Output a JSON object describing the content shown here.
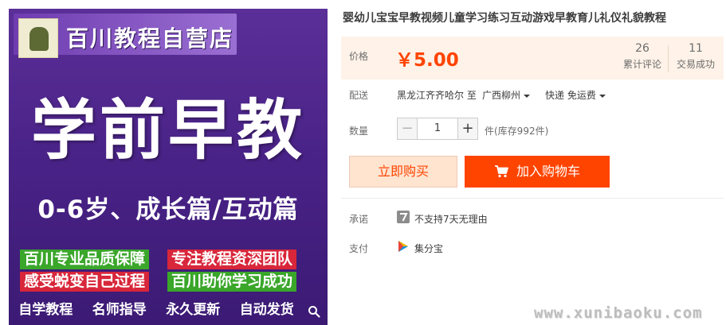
{
  "image": {
    "shop_name": "百川教程自营店",
    "headline": "学前早教",
    "subline": "0-6岁、成长篇/互动篇",
    "tags": [
      "百川专业品质保障",
      "专注教程资深团队",
      "感受蜕变自己过程",
      "百川助你学习成功"
    ],
    "bottom_items": [
      "自学教程",
      "名师指导",
      "永久更新",
      "自动发货"
    ],
    "colors": {
      "background": "#4a2388",
      "green_tag": "#3aa62a",
      "red_tag": "#d8263a"
    }
  },
  "product": {
    "title": "婴幼儿宝宝早教视频儿童学习练习互动游戏早教育儿礼仪礼貌教程"
  },
  "price": {
    "label": "价格",
    "value": "￥5.00",
    "reviews_count": "26",
    "reviews_label": "累计评论",
    "sales_count": "11",
    "sales_label": "交易成功"
  },
  "shipping": {
    "label": "配送",
    "from": "黑龙江齐齐哈尔",
    "to_word": "至",
    "to": "广西柳州",
    "method": "快递 免运费"
  },
  "quantity": {
    "label": "数量",
    "value": "1",
    "minus": "−",
    "plus": "+",
    "stock": "件(库存992件)"
  },
  "actions": {
    "buy_now": "立即购买",
    "add_to_cart": "加入购物车",
    "accent": "#ff4400"
  },
  "promise": {
    "label": "承诺",
    "text": "不支持7天无理由"
  },
  "payment": {
    "label": "支付",
    "text": "集分宝"
  },
  "watermark": "www.xunibaoku.com"
}
